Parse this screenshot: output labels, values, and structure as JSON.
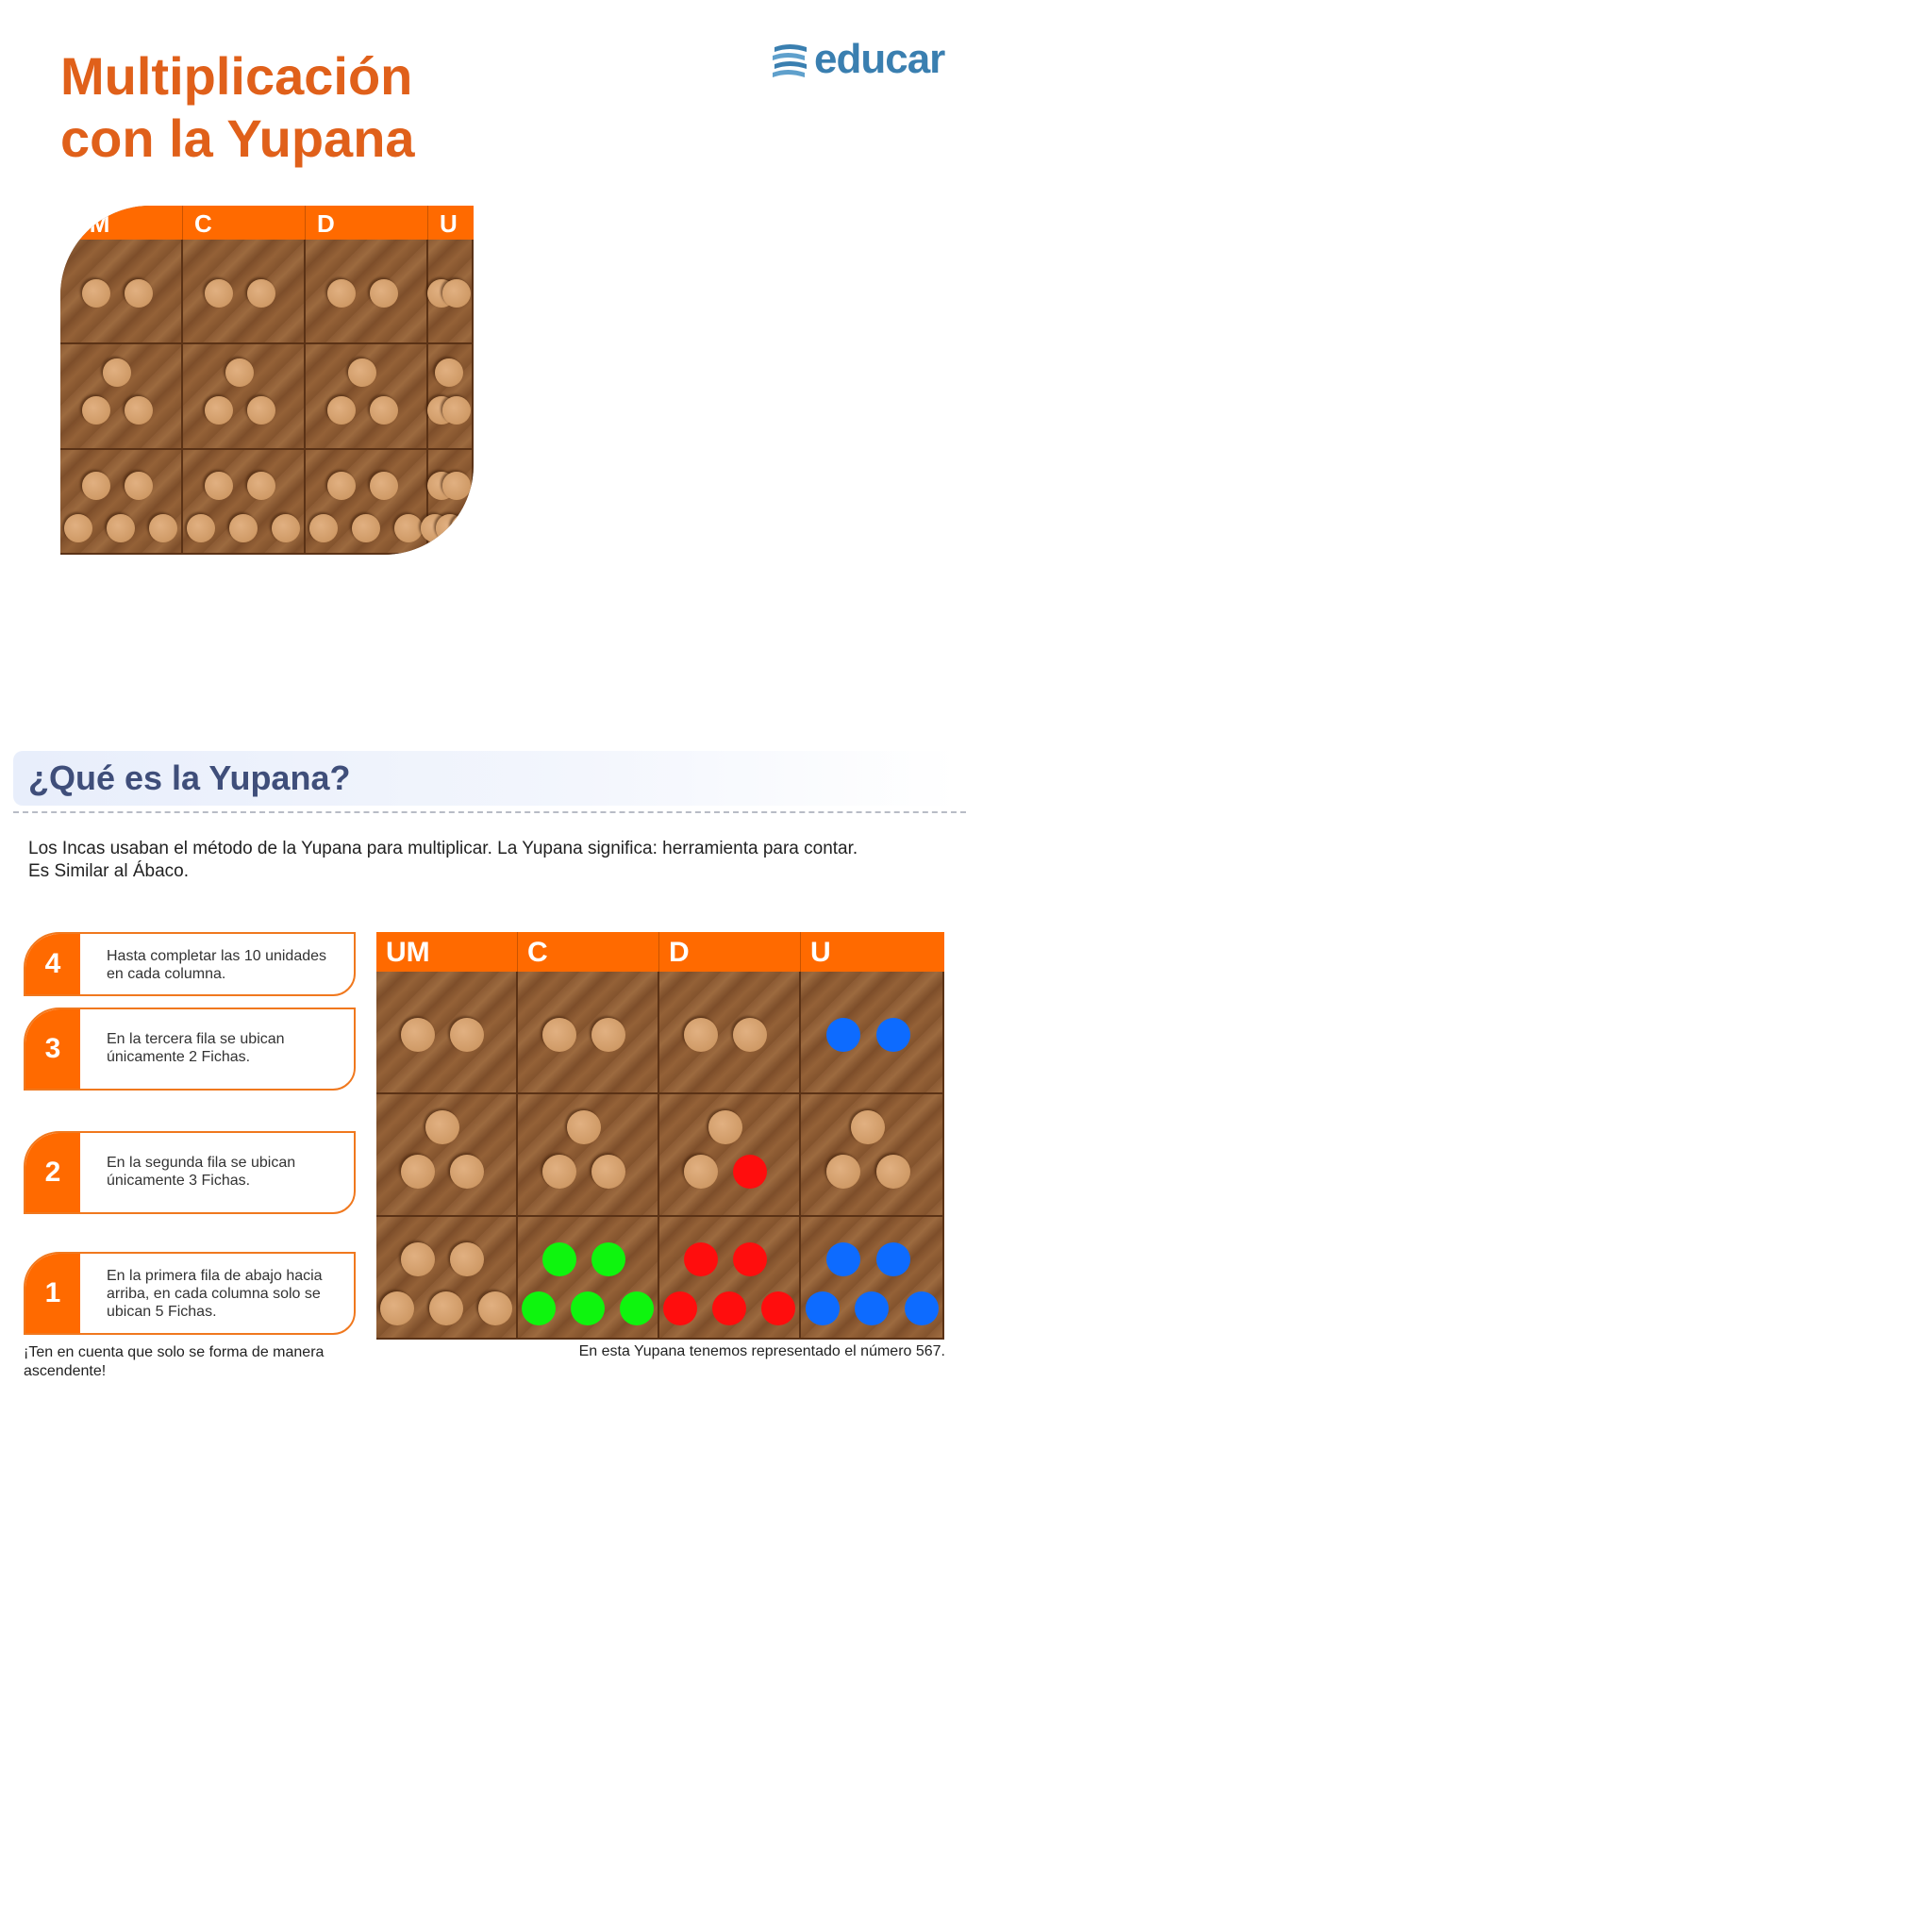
{
  "title": {
    "line1": "Multiplicación",
    "line2": "con la Yupana"
  },
  "logo": {
    "text": "educar"
  },
  "colors": {
    "accent": "#ff6a00",
    "title": "#e0601a",
    "heading": "#3f4e7a",
    "logo": "#3a7fb0",
    "red": "#ff0d0d",
    "green": "#0ef50e",
    "blue": "#0d6bff"
  },
  "board_top": {
    "columns": [
      "UM",
      "C",
      "D",
      "U"
    ],
    "rows": [
      {
        "label": "third row",
        "chips_per_column": 2
      },
      {
        "label": "second row",
        "chips_per_column": 3
      },
      {
        "label": "first row",
        "chips_per_column": 5
      }
    ]
  },
  "section": {
    "title": "¿Qué es la Yupana?",
    "intro_line1": "Los Incas usaban el método de la Yupana para multiplicar. La Yupana significa: herramienta para contar.",
    "intro_line2": "Es Similar al Ábaco."
  },
  "steps": [
    {
      "number": "4",
      "text_line1": "Hasta completar las 10 unidades",
      "text_line2": "en cada columna."
    },
    {
      "number": "3",
      "text_line1": "En la tercera fila se ubican",
      "text_line2": "únicamente 2 Fichas."
    },
    {
      "number": "2",
      "text_line1": "En la segunda fila se  ubican",
      "text_line2": "únicamente 3 Fichas."
    },
    {
      "number": "1",
      "text_line1": "En la primera fila de abajo hacia",
      "text_line2": "arriba, en cada columna solo se",
      "text_line3": "ubican 5 Fichas."
    }
  ],
  "note": {
    "line1": "¡Ten en cuenta que solo se forma de manera",
    "line2": "ascendente!"
  },
  "board_example": {
    "columns": [
      "UM",
      "C",
      "D",
      "U"
    ],
    "represented_number": 567,
    "colored_chips": {
      "UM": {
        "row3": 0,
        "row2": 0,
        "row1": 0,
        "color": "none"
      },
      "C": {
        "row3": 0,
        "row2": 0,
        "row1": 5,
        "color": "green"
      },
      "D": {
        "row3": 0,
        "row2": 1,
        "row1": 5,
        "color": "red"
      },
      "U": {
        "row3": 2,
        "row2": 0,
        "row1": 5,
        "color": "blue"
      }
    }
  },
  "caption": "En esta Yupana tenemos representado el número 567."
}
